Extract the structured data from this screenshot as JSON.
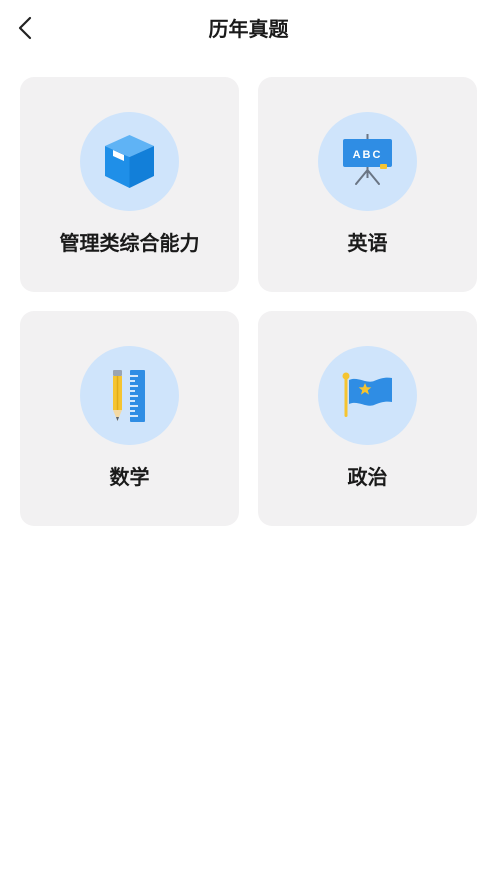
{
  "header": {
    "back_icon": "chevron-left-icon",
    "title": "历年真题"
  },
  "categories": [
    {
      "label": "管理类综合能力",
      "icon": "cube-icon"
    },
    {
      "label": "英语",
      "icon": "abc-board-icon",
      "icon_text": "ABC"
    },
    {
      "label": "数学",
      "icon": "pencil-ruler-icon"
    },
    {
      "label": "政治",
      "icon": "flag-icon"
    }
  ],
  "colors": {
    "card_background": "#f2f1f2",
    "icon_circle": "#cfe4fb",
    "icon_blue": "#2f8de4",
    "icon_yellow": "#f5c431"
  }
}
